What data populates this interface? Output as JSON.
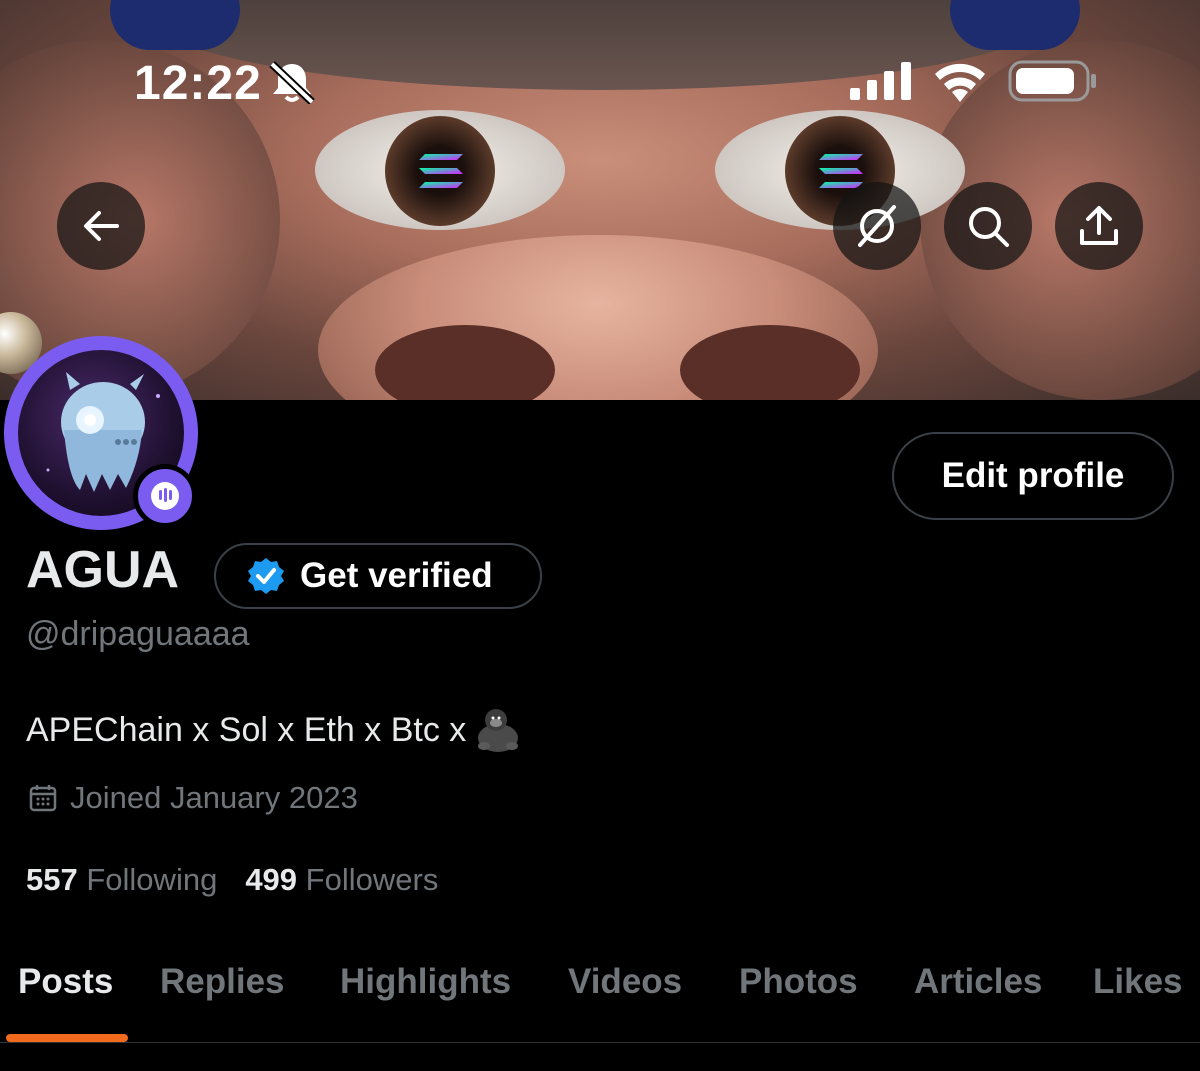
{
  "status_bar": {
    "time": "12:22",
    "icons": [
      "bell-slash-icon",
      "cellular-signal-icon",
      "wifi-icon",
      "battery-icon"
    ]
  },
  "banner": {
    "buttons": [
      "back-arrow-icon",
      "grok-icon",
      "search-icon",
      "share-icon"
    ]
  },
  "profile": {
    "name": "AGUA",
    "handle": "@dripaguaaaa",
    "bio": "APEChain x Sol x Eth x Btc x",
    "bio_emoji": "gorilla",
    "joined": "Joined January 2023",
    "following_count": "557",
    "following_label": "Following",
    "followers_count": "499",
    "followers_label": "Followers",
    "edit_profile_label": "Edit profile",
    "get_verified_label": "Get verified"
  },
  "tabs": {
    "items": [
      {
        "label": "Posts",
        "active": true
      },
      {
        "label": "Replies",
        "active": false
      },
      {
        "label": "Highlights",
        "active": false
      },
      {
        "label": "Videos",
        "active": false
      },
      {
        "label": "Photos",
        "active": false
      },
      {
        "label": "Articles",
        "active": false
      },
      {
        "label": "Likes",
        "active": false
      }
    ]
  },
  "colors": {
    "background": "#000000",
    "primary_text": "#e7e9ea",
    "secondary_text": "#71767b",
    "avatar_ring": "#7b5cf0",
    "verified_blue": "#1d9bf0",
    "tab_indicator": "#f26a1b",
    "border": "#3b4046"
  }
}
